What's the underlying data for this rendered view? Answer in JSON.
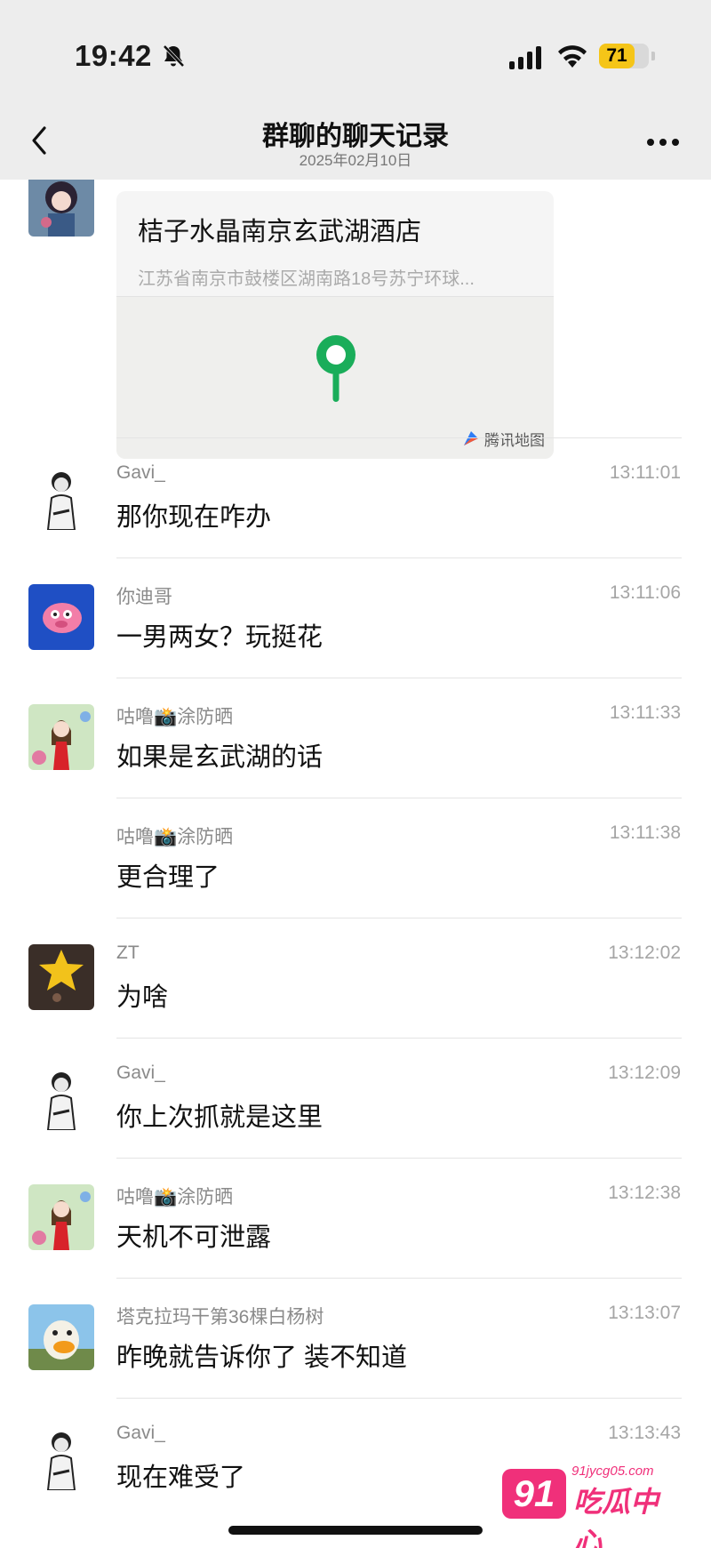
{
  "status_bar": {
    "time": "19:42",
    "battery_level": "71",
    "icons": [
      "bell-slash-icon",
      "cellular-signal-icon",
      "wifi-icon",
      "battery-icon"
    ]
  },
  "nav": {
    "title": "群聊的聊天记录",
    "date": "2025年02月10日",
    "back_icon": "chevron-left-icon",
    "more_icon": "more-dots-icon"
  },
  "location_card": {
    "title": "桔子水晶南京玄武湖酒店",
    "address": "江苏省南京市鼓楼区湖南路18号苏宁环球...",
    "map_provider": "腾讯地图",
    "pin_color": "#1aad5a"
  },
  "messages": [
    {
      "sender": "Gavi_",
      "time": "13:11:01",
      "text": "那你现在咋办",
      "avatar": "avatar-gavi"
    },
    {
      "sender": "你迪哥",
      "time": "13:11:06",
      "text": "一男两女？玩挺花",
      "avatar": "avatar-didi"
    },
    {
      "sender": "咕噜📸涂防晒",
      "time": "13:11:33",
      "text": "如果是玄武湖的话",
      "avatar": "avatar-gulu"
    },
    {
      "sender": "咕噜📸涂防晒",
      "time": "13:11:38",
      "text": "更合理了",
      "avatar": ""
    },
    {
      "sender": "ZT",
      "time": "13:12:02",
      "text": "为啥",
      "avatar": "avatar-zt"
    },
    {
      "sender": "Gavi_",
      "time": "13:12:09",
      "text": "你上次抓就是这里",
      "avatar": "avatar-gavi"
    },
    {
      "sender": "咕噜📸涂防晒",
      "time": "13:12:38",
      "text": "天机不可泄露",
      "avatar": "avatar-gulu"
    },
    {
      "sender": "塔克拉玛干第36棵白杨树",
      "time": "13:13:07",
      "text": "昨晚就告诉你了 装不知道",
      "avatar": "avatar-duck"
    },
    {
      "sender": "Gavi_",
      "time": "13:13:43",
      "text": "现在难受了",
      "avatar": "avatar-gavi"
    }
  ],
  "watermark": {
    "badge": "91",
    "url": "91jycg05.com",
    "text": "吃瓜中心"
  },
  "colors": {
    "bar_bg": "#ededed",
    "battery": "#f5c518",
    "watermark": "#f0307a"
  }
}
